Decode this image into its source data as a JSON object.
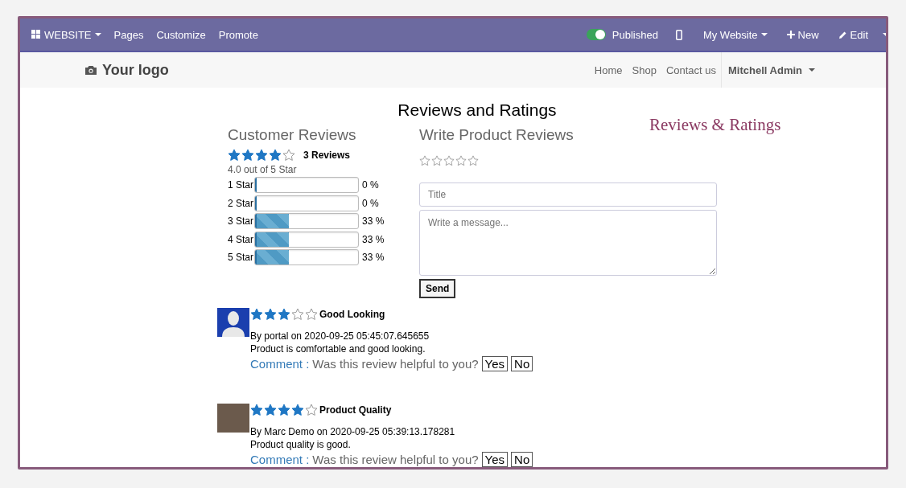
{
  "editor_bar": {
    "app_menu": "WEBSITE",
    "menu": [
      "Pages",
      "Customize",
      "Promote"
    ],
    "publish_toggle": {
      "label": "Published",
      "on": true
    },
    "website_menu": "My Website",
    "new_button": "New",
    "edit_button": "Edit"
  },
  "header": {
    "logo": "Your logo",
    "nav": [
      "Home",
      "Shop",
      "Contact us"
    ],
    "user_menu": "Mitchell Admin"
  },
  "page_title": "Reviews and Ratings",
  "customer_reviews": {
    "heading": "Customer Reviews",
    "stars": 4,
    "count": "3 Reviews",
    "average": "4.0 out of 5 Star",
    "bars": [
      {
        "label": "1 Star",
        "level": 0,
        "percent": "0 %"
      },
      {
        "label": "2 Star",
        "level": 0,
        "percent": "0 %"
      },
      {
        "label": "3 Star",
        "level": 0.33,
        "percent": "33 %"
      },
      {
        "label": "4 Star",
        "level": 0.33,
        "percent": "33 %"
      },
      {
        "label": "5 Star",
        "level": 0.33,
        "percent": "33 %"
      }
    ]
  },
  "write_review": {
    "heading": "Write Product Reviews",
    "stars": 0,
    "title_placeholder": "Title",
    "message_placeholder": "Write a message...",
    "send_button": "Send"
  },
  "side_title": "Reviews & Ratings",
  "reviews": [
    {
      "kind": "silhouette",
      "stars": 3,
      "title": "Good Looking",
      "byline": "By portal on 2020-09-25 05:45:07.645655",
      "text": "Product is comfortable and good looking.",
      "comment_link": "Comment :",
      "question": "Was this review helpful to you?",
      "yes": "Yes",
      "no": "No"
    },
    {
      "kind": "photo",
      "stars": 4,
      "title": "Product Quality",
      "byline": "By Marc Demo on 2020-09-25 05:39:13.178281",
      "text": "Product quality is good.",
      "comment_link": "Comment :",
      "question": "Was this review helpful to you?",
      "yes": "Yes",
      "no": "No"
    }
  ]
}
